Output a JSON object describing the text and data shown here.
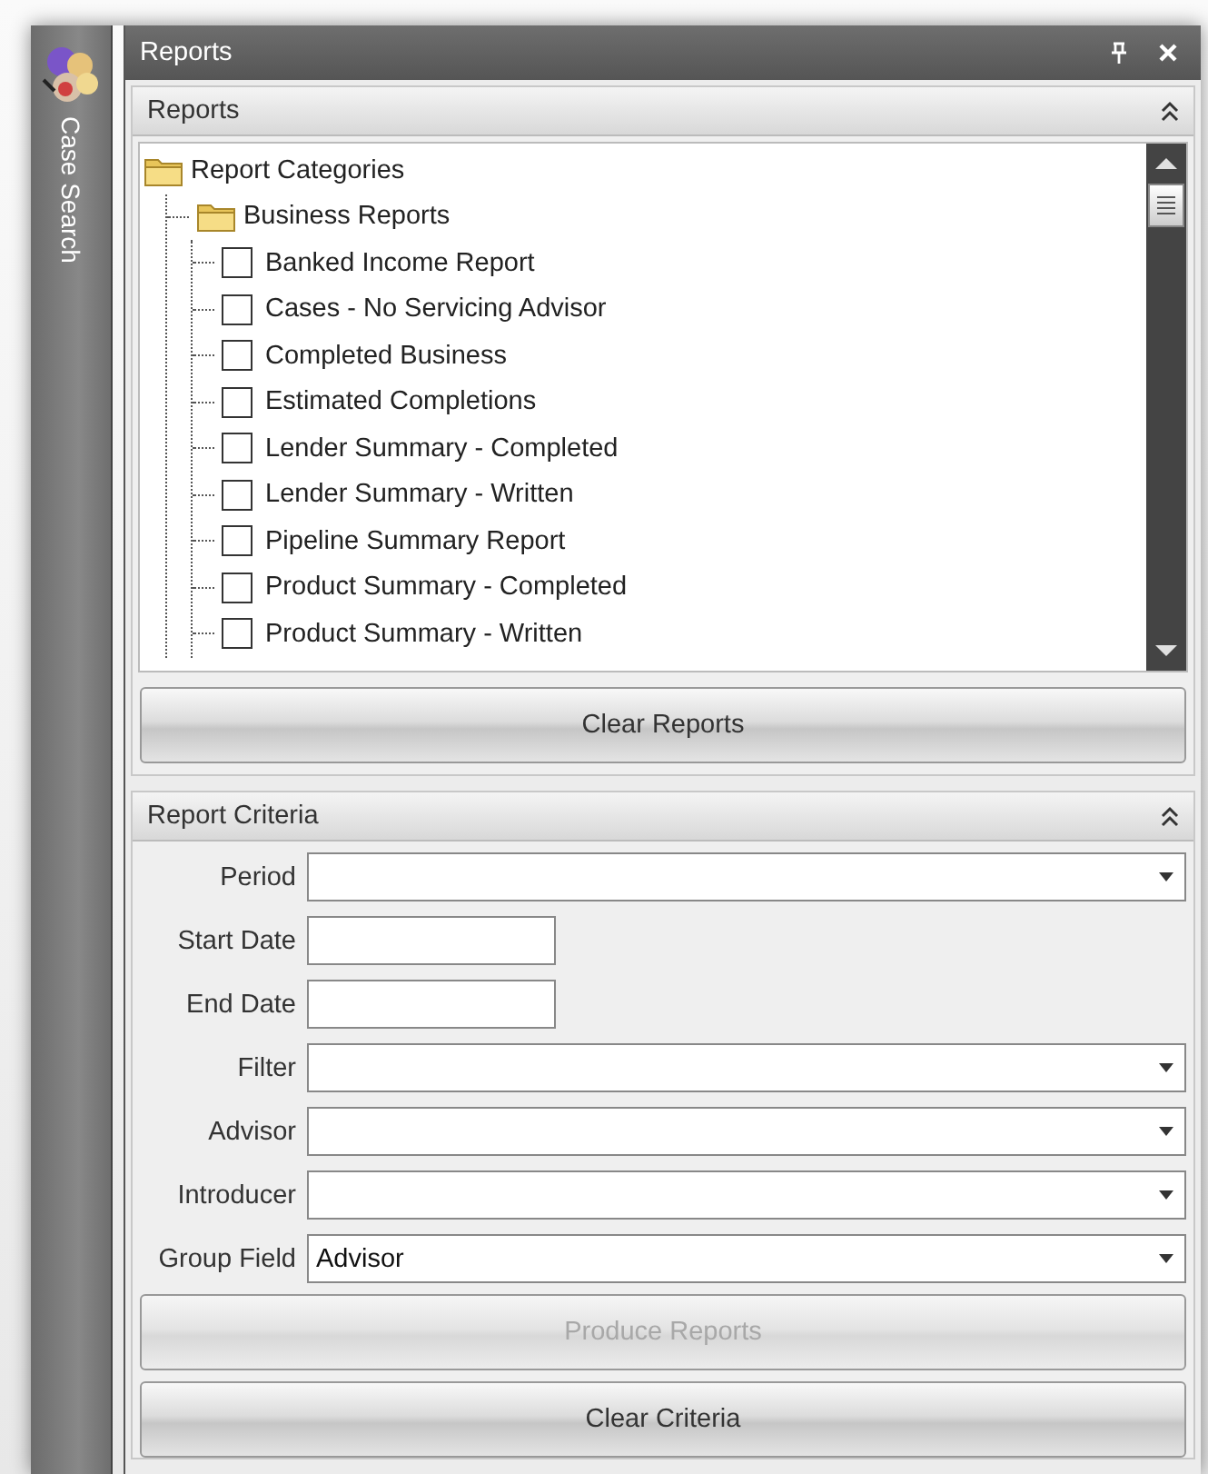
{
  "sidebar": {
    "items": [
      {
        "label": "Case Search",
        "selected": false
      }
    ]
  },
  "window": {
    "title": "Reports"
  },
  "reports_group": {
    "title": "Reports",
    "expanded": true,
    "tree": [
      {
        "kind": "folder",
        "label": "Report Categories",
        "children": [
          {
            "kind": "folder",
            "label": "Business Reports",
            "children": [
              {
                "kind": "report",
                "label": "Banked Income Report",
                "checked": false
              },
              {
                "kind": "report",
                "label": "Cases - No Servicing Advisor",
                "checked": false
              },
              {
                "kind": "report",
                "label": "Completed Business",
                "checked": false
              },
              {
                "kind": "report",
                "label": "Estimated Completions",
                "checked": false
              },
              {
                "kind": "report",
                "label": "Lender Summary - Completed",
                "checked": false
              },
              {
                "kind": "report",
                "label": "Lender Summary - Written",
                "checked": false
              },
              {
                "kind": "report",
                "label": "Pipeline Summary Report",
                "checked": false
              },
              {
                "kind": "report",
                "label": "Product Summary - Completed",
                "checked": false
              },
              {
                "kind": "report",
                "label": "Product Summary - Written",
                "checked": false
              }
            ]
          }
        ]
      }
    ],
    "button": {
      "label": "Clear Reports",
      "disabled": false
    }
  },
  "criteria_group": {
    "title": "Report Criteria",
    "expanded": true,
    "fields": [
      {
        "kind": "combo",
        "label": "Period"
      },
      {
        "kind": "date",
        "label": "Start Date"
      },
      {
        "kind": "date",
        "label": "End Date"
      },
      {
        "kind": "combo",
        "label": "Filter"
      },
      {
        "kind": "combo",
        "label": "Advisor"
      },
      {
        "kind": "combo",
        "label": "Introducer"
      },
      {
        "kind": "combo",
        "label": "Group Field",
        "value": "Advisor"
      }
    ],
    "buttons": [
      {
        "label": "Produce Reports",
        "disabled": true
      },
      {
        "label": "Clear Criteria",
        "disabled": false
      }
    ]
  }
}
